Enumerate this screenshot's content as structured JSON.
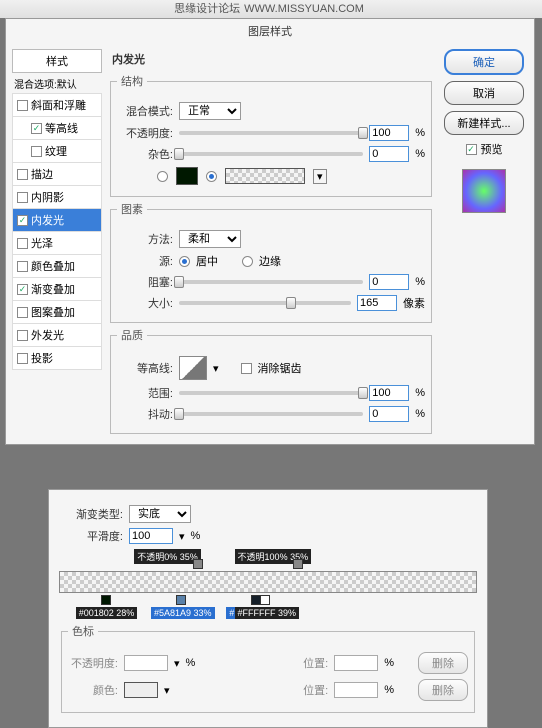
{
  "watermark": {
    "site": "思缘设计论坛",
    "url": "WWW.MISSYUAN.COM"
  },
  "dialog": {
    "title": "图层样式",
    "styles_header": "样式",
    "blend_options": "混合选项:默认",
    "items": [
      {
        "label": "斜面和浮雕",
        "checked": false,
        "sub": false
      },
      {
        "label": "等高线",
        "checked": true,
        "sub": true
      },
      {
        "label": "纹理",
        "checked": false,
        "sub": true
      },
      {
        "label": "描边",
        "checked": false,
        "sub": false
      },
      {
        "label": "内阴影",
        "checked": false,
        "sub": false
      },
      {
        "label": "内发光",
        "checked": true,
        "sub": false,
        "active": true
      },
      {
        "label": "光泽",
        "checked": false,
        "sub": false
      },
      {
        "label": "颜色叠加",
        "checked": false,
        "sub": false
      },
      {
        "label": "渐变叠加",
        "checked": true,
        "sub": false
      },
      {
        "label": "图案叠加",
        "checked": false,
        "sub": false
      },
      {
        "label": "外发光",
        "checked": false,
        "sub": false
      },
      {
        "label": "投影",
        "checked": false,
        "sub": false
      }
    ],
    "panel_title": "内发光",
    "structure": {
      "legend": "结构",
      "blend_mode_label": "混合模式:",
      "blend_mode_value": "正常",
      "opacity_label": "不透明度:",
      "opacity_value": "100",
      "opacity_unit": "%",
      "noise_label": "杂色:",
      "noise_value": "0",
      "noise_unit": "%",
      "solid_color": "#001800"
    },
    "elements": {
      "legend": "图素",
      "technique_label": "方法:",
      "technique_value": "柔和",
      "source_label": "源:",
      "source_center": "居中",
      "source_edge": "边缘",
      "choke_label": "阻塞:",
      "choke_value": "0",
      "choke_unit": "%",
      "size_label": "大小:",
      "size_value": "165",
      "size_unit": "像素"
    },
    "quality": {
      "legend": "品质",
      "contour_label": "等高线:",
      "antialias_label": "消除锯齿",
      "range_label": "范围:",
      "range_value": "100",
      "range_unit": "%",
      "jitter_label": "抖动:",
      "jitter_value": "0",
      "jitter_unit": "%"
    },
    "buttons": {
      "ok": "确定",
      "cancel": "取消",
      "new_style": "新建样式...",
      "preview": "预览"
    }
  },
  "gradient": {
    "type_label": "渐变类型:",
    "type_value": "实底",
    "smooth_label": "平滑度:",
    "smooth_value": "100",
    "smooth_unit": "%",
    "opacity_stops": [
      {
        "text": "不透明0% 35%",
        "pos": 18
      },
      {
        "text": "不透明100% 35%",
        "pos": 42
      }
    ],
    "color_stops": [
      {
        "text": "#001802 28%",
        "pos": 10,
        "bg": "#001802"
      },
      {
        "text": "#5A81A9 33%",
        "pos": 28,
        "bg": "#5A81A9",
        "sel": true
      },
      {
        "text": "#16202A 38%",
        "pos": 46,
        "bg": "#16202A",
        "sel": true
      },
      {
        "text": "#FFFFFF 39%",
        "pos": 48,
        "bg": "#FFFFFF"
      }
    ],
    "stops_legend": "色标",
    "opacity_label": "不透明度:",
    "position_label": "位置:",
    "color_label": "颜色:",
    "delete_label": "删除",
    "pct": "%"
  }
}
